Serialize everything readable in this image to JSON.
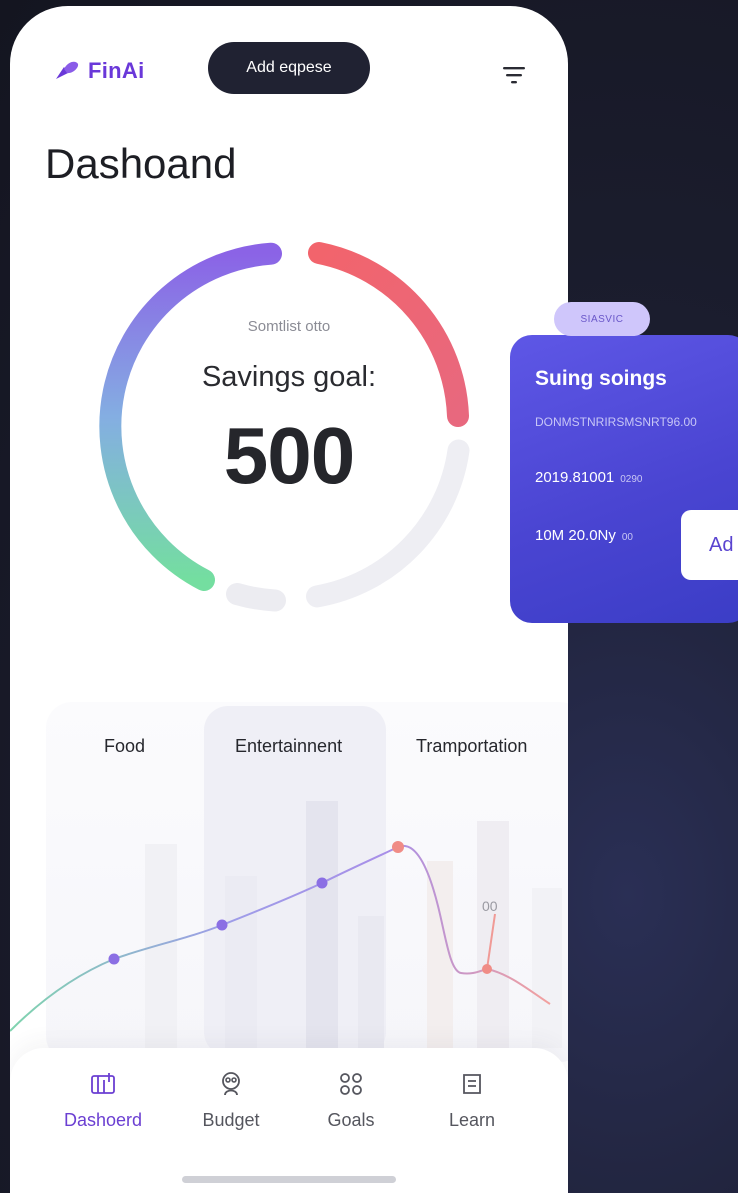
{
  "app": {
    "brand": "FinAi",
    "add_expense_label": "Add eqpese",
    "menu_icon": "filter-lines-icon"
  },
  "dashboard": {
    "title": "Dashoand",
    "gauge": {
      "small_label": "Somtlist otto",
      "label": "Savings goal:",
      "value": "500"
    }
  },
  "categories": [
    "Food",
    "Entertainnent",
    "Tramportation"
  ],
  "chart_data": {
    "type": "line",
    "categories": [
      "Food",
      "Entertainnent",
      "Tramportation"
    ],
    "annotation": "00",
    "grid": false
  },
  "promo": {
    "pill": "SIASVIC",
    "title": "Suing soings",
    "subtitle": "DONMSTNRIRSMSNRT96.00",
    "row1": "2019.81001",
    "row1_note": "0290",
    "row2": "10M 20.0Ny",
    "row2_note": "00",
    "button": "Ad"
  },
  "nav": {
    "items": [
      {
        "label": "Dashoerd",
        "icon": "dashboard-icon",
        "active": true
      },
      {
        "label": "Budget",
        "icon": "budget-icon",
        "active": false
      },
      {
        "label": "Goals",
        "icon": "goals-icon",
        "active": false
      },
      {
        "label": "Learn",
        "icon": "learn-icon",
        "active": false
      }
    ]
  },
  "colors": {
    "brand": "#6a38d9",
    "dark_button": "#202232",
    "gauge_red": "#ef6b73",
    "gauge_purple": "#8b63e6",
    "gauge_green": "#7ddca6",
    "promo_bg": "#4a45d2",
    "nav_active": "#6b3fd2"
  }
}
